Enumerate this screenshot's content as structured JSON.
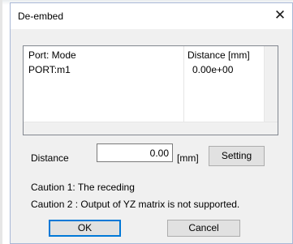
{
  "dialog": {
    "title": "De-embed",
    "close_glyph": "✕"
  },
  "list": {
    "columns": [
      "Port: Mode",
      "Distance [mm]"
    ],
    "rows": [
      {
        "port": "PORT:m1",
        "distance": "0.00e+00"
      }
    ]
  },
  "distance": {
    "label": "Distance",
    "value": "0.00",
    "unit": "[mm]"
  },
  "buttons": {
    "setting": "Setting",
    "ok": "OK",
    "cancel": "Cancel"
  },
  "cautions": [
    "Caution 1: The receding",
    "Caution 2 : Output of YZ matrix is not supported."
  ],
  "colors": {
    "focus_border": "#0078d7",
    "dialog_bg": "#f0f0f0"
  },
  "icons": {
    "close": "close-icon"
  }
}
